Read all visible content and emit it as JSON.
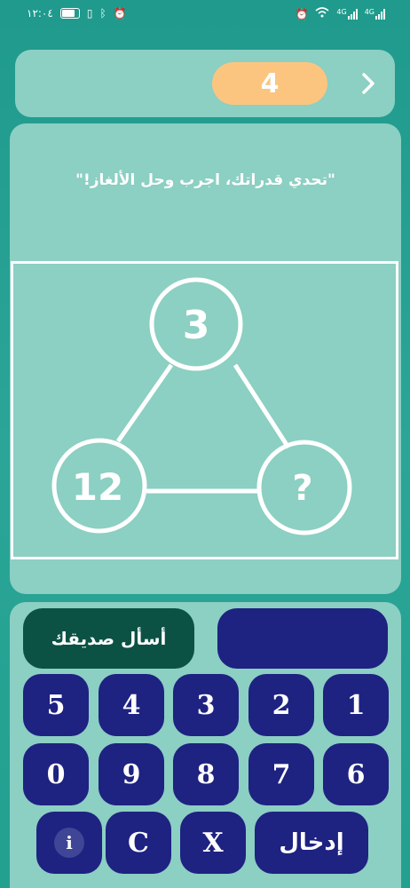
{
  "status_bar": {
    "time": "١٢:٠٤",
    "left_icons": [
      "battery-icon",
      "vibrate-icon",
      "bluetooth-icon",
      "alarm-icon"
    ],
    "right_icons": [
      "alarm-icon",
      "wifi-icon",
      "signal-4g-icon",
      "signal-4g-icon"
    ],
    "net_label_1": "4G",
    "net_label_2": "4G"
  },
  "header": {
    "level": "4",
    "next_icon": "chevron-right-icon"
  },
  "puzzle": {
    "prompt": "\"تحدي قدراتك، اجرب وحل الألغاز!\"",
    "top_value": "3",
    "left_value": "12",
    "right_value": "?"
  },
  "actions": {
    "ask_friend": "أسأل صديقك",
    "answer_value": ""
  },
  "keypad": {
    "row1": [
      "5",
      "4",
      "3",
      "2",
      "1"
    ],
    "row2": [
      "0",
      "9",
      "8",
      "7",
      "6"
    ],
    "info_label": "i",
    "clear_label": "C",
    "delete_label": "X",
    "enter_label": "إدخال"
  },
  "colors": {
    "background": "#1f9a8c",
    "panel": "#8ccfc3",
    "level_pill": "#fcc57f",
    "key": "#1e2281",
    "ask_button": "#0b5245"
  }
}
